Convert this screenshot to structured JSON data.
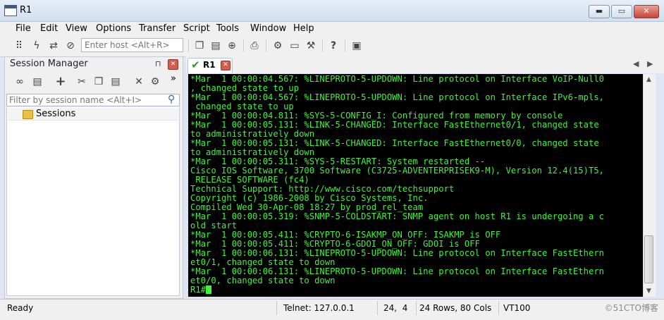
{
  "window": {
    "title": "R1"
  },
  "window_controls": {
    "minimize": "▬",
    "maximize": "▭",
    "close": "✕"
  },
  "menu": [
    "File",
    "Edit",
    "View",
    "Options",
    "Transfer",
    "Script",
    "Tools",
    "Window",
    "Help"
  ],
  "toolbar": {
    "host_placeholder": "Enter host <Alt+R>",
    "icons": [
      "connect-icon",
      "quick-connect-icon",
      "reconnect-icon",
      "disconnect-icon",
      "copy-icon",
      "paste-icon",
      "find-icon",
      "print-icon",
      "settings-icon",
      "keymap-icon",
      "tools-icon",
      "help-icon",
      "sftp-icon"
    ]
  },
  "session_manager": {
    "title": "Session Manager",
    "pin_glyph": "⊓",
    "close_glyph": "✕",
    "more_glyph": "»",
    "filter_placeholder": "Filter by session name <Alt+I>",
    "tree": [
      {
        "label": "Sessions",
        "icon": "folder-icon"
      }
    ]
  },
  "tab": {
    "label": "R1",
    "status_icon": "check-icon",
    "close_glyph": "✕"
  },
  "terminal": {
    "lines": [
      "*Mar  1 00:00:04.567: %LINEPROTO-5-UPDOWN: Line protocol on Interface VoIP-Null0",
      ", changed state to up",
      "*Mar  1 00:00:04.567: %LINEPROTO-5-UPDOWN: Line protocol on Interface IPv6-mpls,",
      " changed state to up",
      "*Mar  1 00:00:04.811: %SYS-5-CONFIG_I: Configured from memory by console",
      "*Mar  1 00:00:05.131: %LINK-5-CHANGED: Interface FastEthernet0/1, changed state",
      "to administratively down",
      "*Mar  1 00:00:05.131: %LINK-5-CHANGED: Interface FastEthernet0/0, changed state",
      "to administratively down",
      "*Mar  1 00:00:05.311: %SYS-5-RESTART: System restarted --",
      "Cisco IOS Software, 3700 Software (C3725-ADVENTERPRISEK9-M), Version 12.4(15)T5,",
      " RELEASE SOFTWARE (fc4)",
      "Technical Support: http://www.cisco.com/techsupport",
      "Copyright (c) 1986-2008 by Cisco Systems, Inc.",
      "Compiled Wed 30-Apr-08 18:27 by prod_rel_team",
      "*Mar  1 00:00:05.319: %SNMP-5-COLDSTART: SNMP agent on host R1 is undergoing a c",
      "old start",
      "*Mar  1 00:00:05.411: %CRYPTO-6-ISAKMP_ON_OFF: ISAKMP is OFF",
      "*Mar  1 00:00:05.411: %CRYPTO-6-GDOI_ON_OFF: GDOI is OFF",
      "*Mar  1 00:00:06.131: %LINEPROTO-5-UPDOWN: Line protocol on Interface FastEthern",
      "et0/1, changed state to down",
      "*Mar  1 00:00:06.131: %LINEPROTO-5-UPDOWN: Line protocol on Interface FastEthern",
      "et0/0, changed state to down"
    ],
    "prompt": "R1#",
    "text_color": "#3ff23a",
    "background": "#000000"
  },
  "status": {
    "ready": "Ready",
    "connection": "Telnet: 127.0.0.1",
    "cursor_pos": "24,  4",
    "size": "24 Rows, 80 Cols",
    "emulation": "VT100",
    "watermark": "©51CTO博客"
  }
}
